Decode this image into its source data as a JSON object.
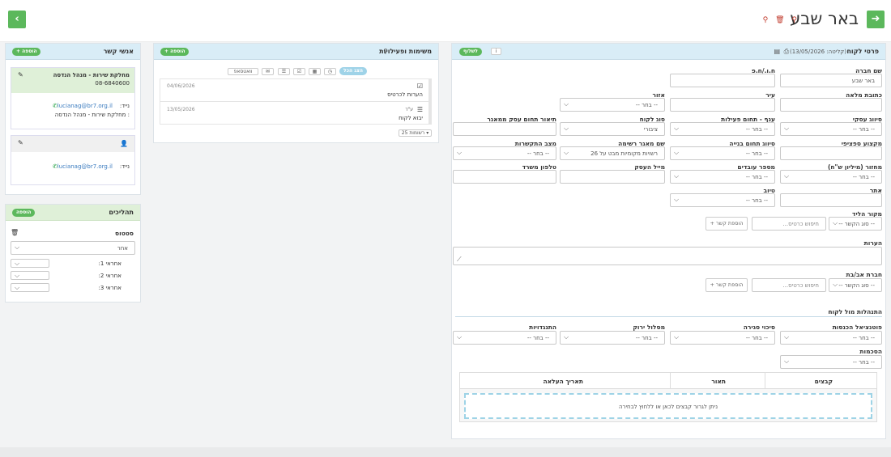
{
  "header": {
    "title": "באר שבע",
    "exit_icon": "sign-out-icon",
    "back_icon": "chevron-left-icon",
    "icons": "⚲ 🗑 ⚲"
  },
  "details": {
    "title": "פרטי לקוח",
    "created": "(קליטה: 13/05/2026)",
    "archive_label": "לשלוף",
    "fields": {
      "company": {
        "label": "שם חברה",
        "value": "באר שבע"
      },
      "id": {
        "label": "ח.ו./ח.פ"
      },
      "address": {
        "label": "כתובת מלאה"
      },
      "city": {
        "label": "עיר"
      },
      "region": {
        "label": "אזור",
        "value": "-- בחר --"
      },
      "biz_class": {
        "label": "סיווג עסקי",
        "value": "-- בחר --"
      },
      "branch": {
        "label": "ענף - תחום פעילות",
        "value": "-- בחר --"
      },
      "cust_type": {
        "label": "סוג לקוח",
        "value": "ציבורי"
      },
      "biz_desc": {
        "label": "תיאור תחום עסק ממאגר"
      },
      "specialty": {
        "label": "מקצוע ספציפי"
      },
      "build_class": {
        "label": "סיווג תחום בנייה",
        "value": "-- בחר --"
      },
      "db_name": {
        "label": "שם מאגר רשימה",
        "value": "רשויות מקומיות מבט על 26"
      },
      "contact_state": {
        "label": "מצב התקשרות",
        "value": "-- בחר --"
      },
      "turnover": {
        "label": "מחזור (מיליון ש\"ח)",
        "value": "-- בחר --"
      },
      "employees": {
        "label": "מספר עובדים",
        "value": "-- בחר --"
      },
      "employer_email": {
        "label": "מייל העסק"
      },
      "office_phone": {
        "label": "טלפון משרד"
      },
      "site": {
        "label": "אתר"
      },
      "quality": {
        "label": "טיוב",
        "value": "-- בחר --"
      },
      "lead_source": {
        "label": "מקור הליד",
        "type_value": "-- סוג הקשר --",
        "search_placeholder": "חיפוש כרטיס...",
        "add_link": "+ הוספת קשר"
      },
      "notes": {
        "label": "הערות"
      },
      "parent": {
        "label": "חברת אב/בת",
        "type_value": "-- סוג הקשר --",
        "search_placeholder": "חיפוש כרטיס...",
        "add_link": "+ הוספת קשר"
      }
    },
    "behavior": {
      "title": "התנהלות מול לקוח",
      "income": {
        "label": "פוטנציאל הכנסות",
        "value": "-- בחר --"
      },
      "closing": {
        "label": "סיכוי סגירה",
        "value": "-- בחר --"
      },
      "green_track": {
        "label": "מסלול ירוק",
        "value": "-- בחר --"
      },
      "opposition": {
        "label": "התנגדויות",
        "value": "-- בחר --"
      },
      "agreements": {
        "label": "הסכמות",
        "value": "-- בחר --"
      }
    },
    "files": {
      "col_files": "קבצים",
      "col_desc": "תאור",
      "col_date": "תאריך העלאה",
      "drop_text": "ניתן לגרור קבצים לכאן או ללחוץ לבחירה"
    }
  },
  "tasks": {
    "title": "משימות ופעילויות",
    "add_label": "+ הוספה",
    "filter_label": "הצג הכל",
    "whatsapp_label": "וואטסאפ",
    "items": [
      {
        "date": "04/06/2026",
        "text": "הערות לכרטיס"
      },
      {
        "date": "13/05/2026",
        "text": "יבוא לקוח",
        "sub": "ע\"ד"
      }
    ],
    "page_size": "25 רשומות"
  },
  "contacts": {
    "title": "אנשי קשר",
    "add_label": "הוספה",
    "cards": [
      {
        "name": "מחלקת שירות - מנהל הנדסה",
        "phone": "08-6840600",
        "email": "lucianag@br7.org.il",
        "mobile_label": "נייד:",
        "dept": ": מחלקת שירות - מנהל הנדסה"
      },
      {
        "email": "lucianag@br7.org.il",
        "mobile_label": "נייד:"
      }
    ]
  },
  "processes": {
    "title": "תהליכים",
    "add_label": "הוספה",
    "status_label": "סטטוס",
    "status_value": "אחר",
    "resp1": "אחראי 1:",
    "resp2": "אחראי 2:",
    "resp3": "אחראי 3:"
  }
}
